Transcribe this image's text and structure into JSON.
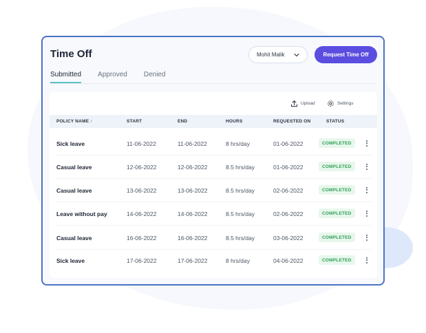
{
  "window": {
    "title": "Time Off"
  },
  "header": {
    "user_select_value": "Mohit Malik",
    "request_button_label": "Request Time Off"
  },
  "tabs": [
    {
      "label": "Submitted",
      "active": true
    },
    {
      "label": "Approved",
      "active": false
    },
    {
      "label": "Denied",
      "active": false
    }
  ],
  "toolbar": {
    "upload_label": "Upload",
    "settings_label": "Settings",
    "upload_icon": "upload-icon",
    "settings_icon": "gear-icon"
  },
  "table": {
    "columns": [
      "POLICY NAME ↑",
      "START",
      "END",
      "HOURS",
      "REQUESTED ON",
      "STATUS"
    ],
    "rows": [
      {
        "policy": "Sick leave",
        "start": "11-06-2022",
        "end": "11-06-2022",
        "hours": "8 hrs/day",
        "requested_on": "01-06-2022",
        "status": "COMPLETED"
      },
      {
        "policy": "Casual leave",
        "start": "12-06-2022",
        "end": "12-06-2022",
        "hours": "8.5 hrs/day",
        "requested_on": "01-06-2022",
        "status": "COMPLETED"
      },
      {
        "policy": "Casual leave",
        "start": "13-06-2022",
        "end": "13-06-2022",
        "hours": "8.5 hrs/day",
        "requested_on": "02-06-2022",
        "status": "COMPLETED"
      },
      {
        "policy": "Leave without pay",
        "start": "14-06-2022",
        "end": "14-06-2022",
        "hours": "8.5 hrs/day",
        "requested_on": "02-06-2022",
        "status": "COMPLETED"
      },
      {
        "policy": "Casual leave",
        "start": "16-06-2022",
        "end": "16-06-2022",
        "hours": "8.5 hrs/day",
        "requested_on": "03-06-2022",
        "status": "COMPLETED"
      },
      {
        "policy": "Sick leave",
        "start": "17-06-2022",
        "end": "17-06-2022",
        "hours": "8 hrs/day",
        "requested_on": "04-06-2022",
        "status": "COMPLETED"
      }
    ]
  },
  "colors": {
    "accent": "#5a4de0",
    "card_border": "#4a72c4",
    "status_completed_bg": "#e7f7ec",
    "status_completed_text": "#2f9e55",
    "tab_underline": "#5ec2c4"
  }
}
